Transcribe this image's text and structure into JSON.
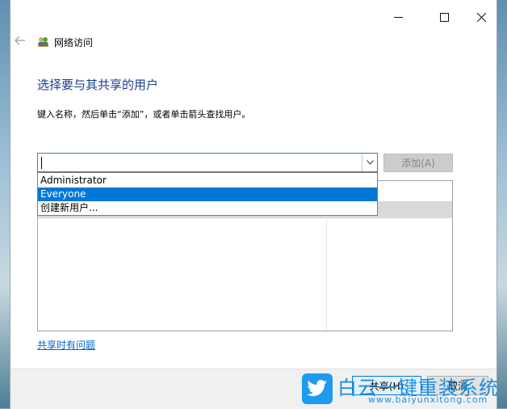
{
  "window": {
    "title": "网络访问",
    "controls": {
      "minimize": "—",
      "maximize": "☐",
      "close": "✕"
    }
  },
  "nav": {
    "back_icon": "arrow-left-icon"
  },
  "heading": "选择要与其共享的用户",
  "instruction": "键入名称，然后单击“添加”，或者单击箭头查找用户。",
  "combo": {
    "value": "",
    "arrow": "⌄"
  },
  "add_button": "添加(A)",
  "dropdown": {
    "items": [
      "Administrator",
      "Everyone",
      "创建新用户..."
    ],
    "selected": "Everyone"
  },
  "help_link": "共享时有问题",
  "footer": {
    "share_button": "共享(H)",
    "cancel_button": "取消"
  },
  "watermark": {
    "text": "白云一键重装系统",
    "url": "www.baiyunxitong.com"
  },
  "colors": {
    "heading": "#1a3e8c",
    "selection": "#0078d7",
    "link": "#0066cc"
  }
}
